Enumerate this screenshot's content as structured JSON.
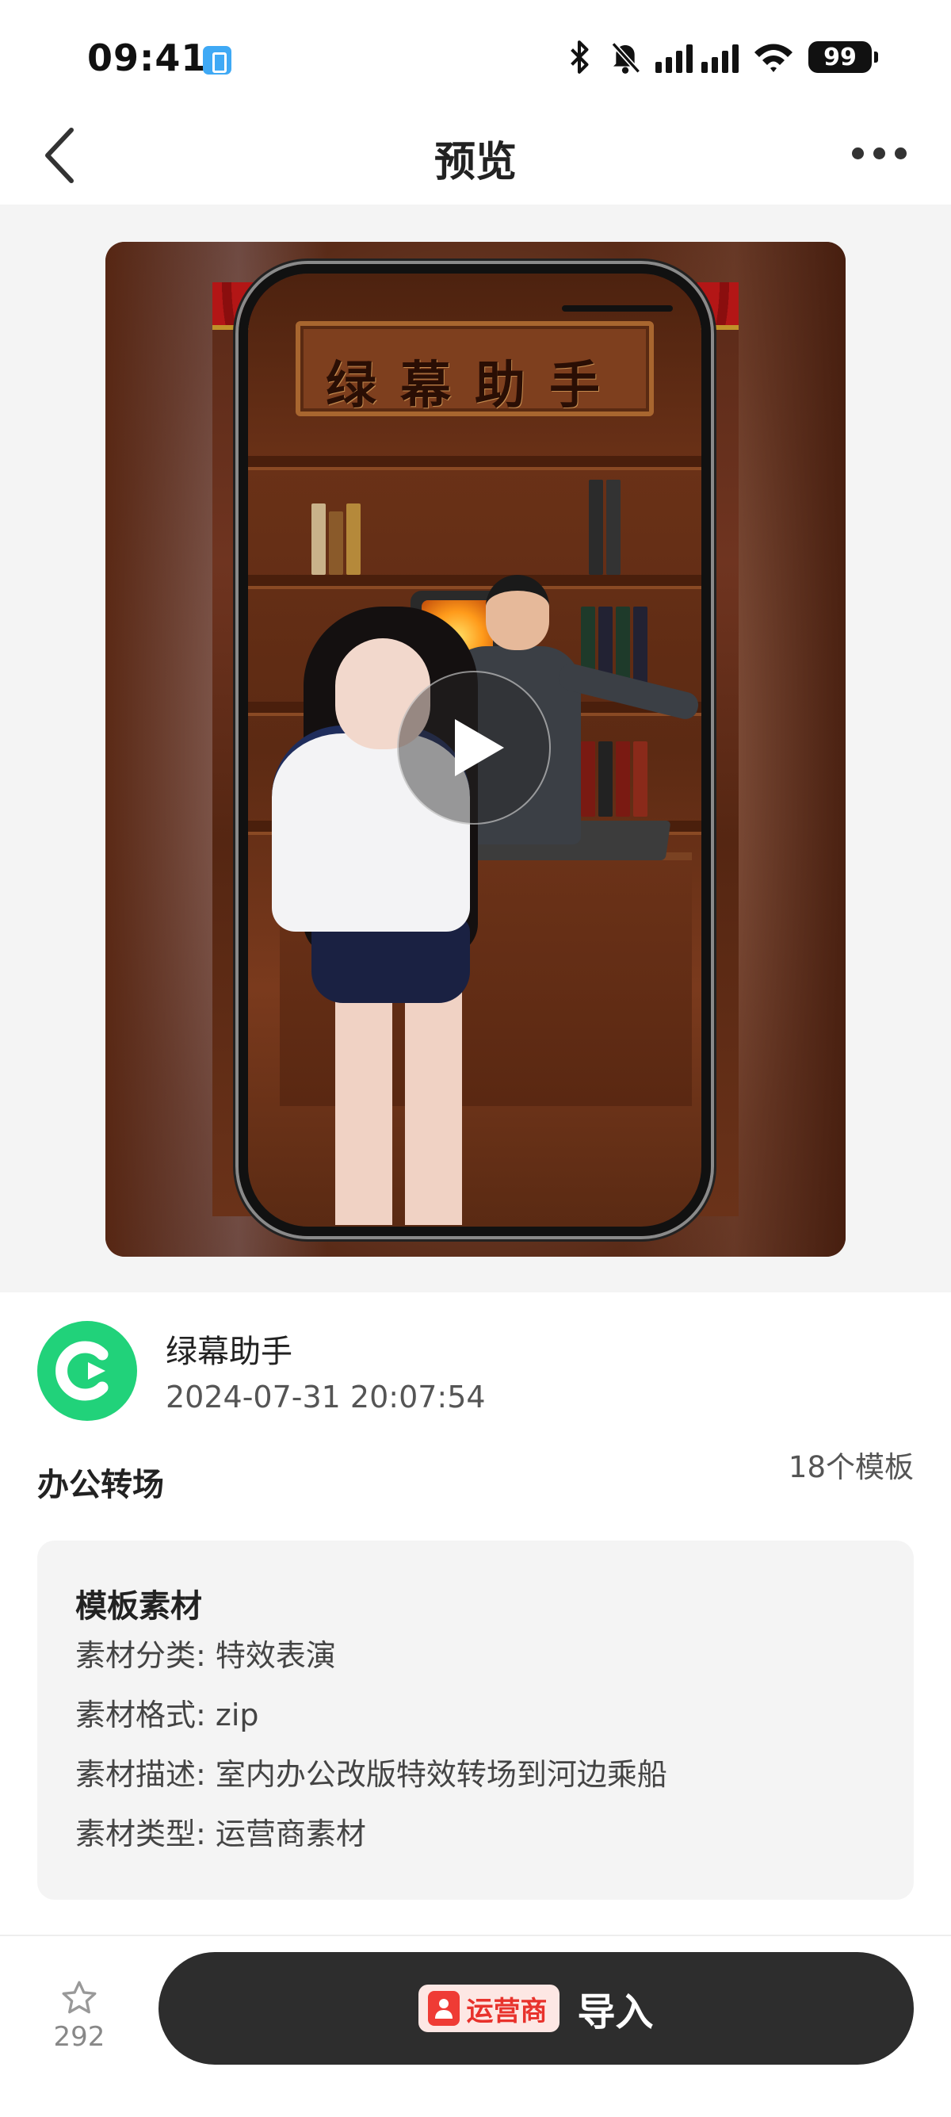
{
  "status_bar": {
    "time": "09:41",
    "battery": "99",
    "icons": [
      "app-notification-icon",
      "bluetooth-icon",
      "bell-muted-icon",
      "cellular-signal-icon",
      "wifi-icon",
      "battery-icon"
    ]
  },
  "nav": {
    "title": "预览",
    "back_icon": "chevron-left-icon",
    "more_icon": "more-dots-icon"
  },
  "preview": {
    "sign_text": "绿幕助手",
    "play_icon": "play-icon"
  },
  "author": {
    "name": "绿幕助手",
    "publish_time": "2024-07-31 20:07:54",
    "avatar_color": "#21d27a"
  },
  "template": {
    "title": "办公转场",
    "count": "18个模板"
  },
  "details": {
    "heading": "模板素材",
    "lines": [
      "素材分类: 特效表演",
      "素材格式: zip",
      "素材描述: 室内办公改版特效转场到河边乘船",
      "素材类型: 运营商素材"
    ]
  },
  "bottom_bar": {
    "favorite_count": "292",
    "carrier_tag": "运营商",
    "import_label": "导入",
    "button_color": "#2d2d2d",
    "carrier_color": "#e8322c"
  }
}
